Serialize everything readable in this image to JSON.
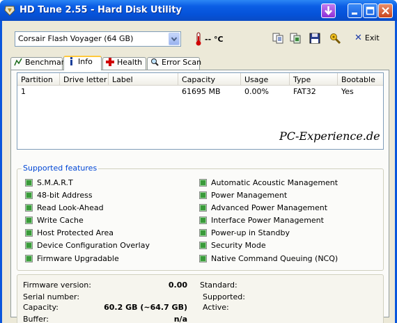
{
  "window": {
    "title": "HD Tune 2.55 - Hard Disk Utility"
  },
  "toolbar": {
    "drive_selected": "Corsair Flash Voyager (64 GB)",
    "temperature": "-- °C",
    "exit_label": "Exit"
  },
  "tabs": [
    {
      "label": "Benchmark",
      "icon": "graph-icon"
    },
    {
      "label": "Info",
      "icon": "info-icon"
    },
    {
      "label": "Health",
      "icon": "health-cross-icon"
    },
    {
      "label": "Error Scan",
      "icon": "magnifier-icon"
    }
  ],
  "partitions": {
    "headers": [
      "Partition",
      "Drive letter",
      "Label",
      "Capacity",
      "Usage",
      "Type",
      "Bootable"
    ],
    "rows": [
      [
        "1",
        "",
        "",
        "61695 MB",
        "0.00%",
        "FAT32",
        "Yes"
      ]
    ],
    "watermark": "PC-Experience.de"
  },
  "features": {
    "title": "Supported features",
    "left": [
      "S.M.A.R.T",
      "48-bit Address",
      "Read Look-Ahead",
      "Write Cache",
      "Host Protected Area",
      "Device Configuration Overlay",
      "Firmware Upgradable"
    ],
    "right": [
      "Automatic Acoustic Management",
      "Power Management",
      "Advanced Power Management",
      "Interface Power Management",
      "Power-up in Standby",
      "Security Mode",
      "Native Command Queuing (NCQ)"
    ]
  },
  "info": {
    "firmware_label": "Firmware version:",
    "firmware_value": "0.00",
    "serial_label": "Serial number:",
    "serial_value": "",
    "capacity_label": "Capacity:",
    "capacity_value": "60.2 GB (~64.7 GB)",
    "buffer_label": "Buffer:",
    "buffer_value": "n/a",
    "standard_label": "Standard:",
    "supported_label": "Supported:",
    "active_label": "Active:"
  },
  "colors": {
    "titlebar": "#0552d8",
    "group_title": "#0046d5",
    "check_fill": "#3a9a3a"
  }
}
